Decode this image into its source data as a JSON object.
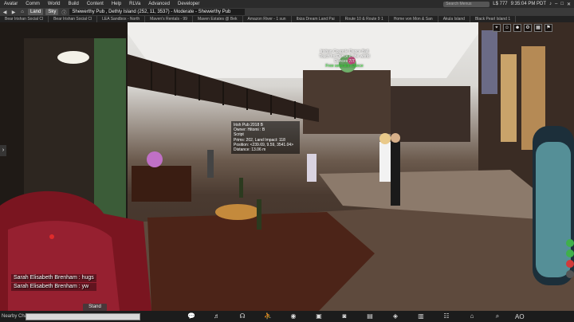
{
  "menu": {
    "items": [
      "Avatar",
      "Comm",
      "World",
      "Build",
      "Content",
      "Help",
      "RLVa",
      "Advanced",
      "Developer"
    ],
    "search_placeholder": "Search Menus",
    "balance": "L$ 777",
    "clock": "9:35:04 PM PDT"
  },
  "location_bar": {
    "land_label": "Land",
    "sky_label": "Sky",
    "location": "Shewerthy Pub , Dethly Island (252, 11, 3537) - Moderate - Shewerthy Pub"
  },
  "favorites": [
    "Bear Irishan Social Cl",
    "Bear Irishan Social Cl",
    "LEA Sandbox - North",
    "Maven's Rentals - 99",
    "Maven Estates @ Bek",
    "Amazon River - 1 sun",
    "Ibiza Dream Land Pai",
    "Route 10 & Route 9 1",
    "Home von Mon & San",
    "Akula Island",
    "Black Pearl Island 1"
  ],
  "hover_tip": {
    "title": "Irish Pub 2018 B",
    "owner": "Owner: Hitomi : B",
    "type": "Script",
    "prims": "Prims: 202, Land Impact: 118",
    "position": "Position: <239.69, 9.59, 3541.04>",
    "distance": "Distance: 13.06 m"
  },
  "float_text": {
    "line1": "Irishan Coupole Dance Ball",
    "line2": "Touch for Dance in the world",
    "line3": "Dances 7/7",
    "line4": "Free selection Dance"
  },
  "chat": {
    "lines": [
      "Sarah Elisabeth Brenham : hugs",
      "Sarah Elisabeth Brenham : yw"
    ],
    "nearby_label": "Nearby Chat",
    "input_value": ""
  },
  "stand_label": "Stand",
  "toolbar": {
    "icons": [
      "speech-bubble-icon",
      "microphone-icon",
      "headphones-icon",
      "walk-icon",
      "eye-icon",
      "camera-icon",
      "snapshot-icon",
      "map-icon",
      "minimap-icon",
      "inventory-icon",
      "people-icon",
      "places-icon",
      "search-icon"
    ],
    "ao_label": "AO"
  },
  "colors": {
    "menu_bg": "#2b2b2b",
    "toolbar_bg": "#1c1c1c",
    "float_text_green": "#39e639"
  }
}
